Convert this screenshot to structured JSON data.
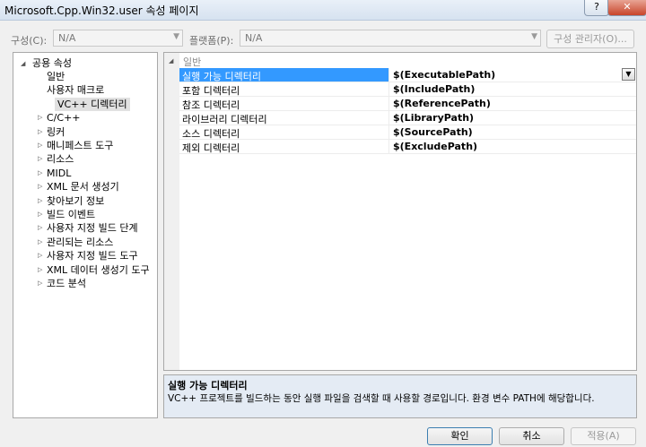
{
  "window": {
    "title": "Microsoft.Cpp.Win32.user 속성 페이지",
    "help_glyph": "?",
    "close_glyph": "✕"
  },
  "toolbar": {
    "config_label": "구성(C):",
    "config_value": "N/A",
    "platform_label": "플랫폼(P):",
    "platform_value": "N/A",
    "config_manager_label": "구성 관리자(O)..."
  },
  "tree": {
    "root": "공용 속성",
    "items": [
      {
        "label": "일반",
        "expandable": false
      },
      {
        "label": "사용자 매크로",
        "expandable": false
      },
      {
        "label": "VC++ 디렉터리",
        "expandable": false,
        "selected": true
      },
      {
        "label": "C/C++",
        "expandable": true
      },
      {
        "label": "링커",
        "expandable": true
      },
      {
        "label": "매니페스트 도구",
        "expandable": true
      },
      {
        "label": "리소스",
        "expandable": true
      },
      {
        "label": "MIDL",
        "expandable": true
      },
      {
        "label": "XML 문서 생성기",
        "expandable": true
      },
      {
        "label": "찾아보기 정보",
        "expandable": true
      },
      {
        "label": "빌드 이벤트",
        "expandable": true
      },
      {
        "label": "사용자 지정 빌드 단계",
        "expandable": true
      },
      {
        "label": "관리되는 리소스",
        "expandable": true
      },
      {
        "label": "사용자 지정 빌드 도구",
        "expandable": true
      },
      {
        "label": "XML 데이터 생성기 도구",
        "expandable": true
      },
      {
        "label": "코드 분석",
        "expandable": true
      }
    ]
  },
  "grid": {
    "category": "일반",
    "rows": [
      {
        "name": "실행 가능 디렉터리",
        "value": "$(ExecutablePath)",
        "selected": true
      },
      {
        "name": "포함 디렉터리",
        "value": "$(IncludePath)"
      },
      {
        "name": "참조 디렉터리",
        "value": "$(ReferencePath)"
      },
      {
        "name": "라이브러리 디렉터리",
        "value": "$(LibraryPath)"
      },
      {
        "name": "소스 디렉터리",
        "value": "$(SourcePath)"
      },
      {
        "name": "제외 디렉터리",
        "value": "$(ExcludePath)"
      }
    ]
  },
  "description": {
    "title": "실행 가능 디렉터리",
    "text": "VC++ 프로젝트를 빌드하는 동안 실행 파일을 검색할 때 사용할 경로입니다. 환경 변수 PATH에 해당합니다."
  },
  "buttons": {
    "ok": "확인",
    "cancel": "취소",
    "apply": "적용(A)"
  }
}
